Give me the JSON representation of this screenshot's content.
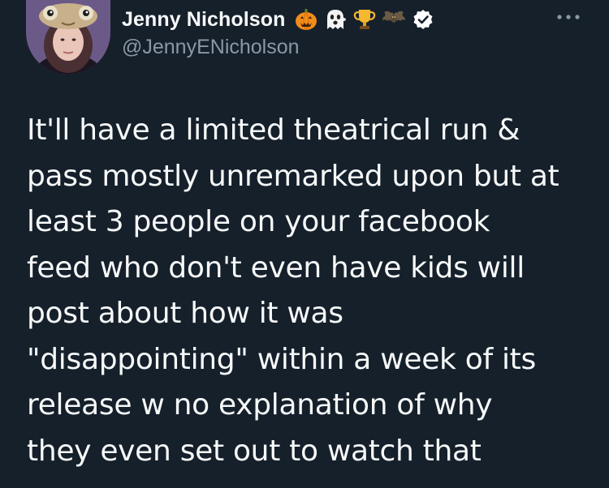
{
  "tweet": {
    "author": {
      "display_name": "Jenny Nicholson",
      "handle": "@JennyENicholson",
      "badges": [
        "jack-o-lantern-icon",
        "ghost-icon",
        "trophy-icon",
        "bat-icon",
        "verified-badge-icon"
      ]
    },
    "more_icon": "more-options-icon",
    "text": "It'll have a limited theatrical run &\npass mostly unremarked upon but at\nleast 3 people on your facebook\nfeed who don't even have kids will\npost about how it was\n\"disappointing\" within a week of its\nrelease w no explanation of why\nthey even set out to watch that"
  },
  "colors": {
    "background": "#15202b",
    "primary_text": "#f7f9f9",
    "secondary_text": "#8b98a5",
    "verified": "#ffffff"
  }
}
